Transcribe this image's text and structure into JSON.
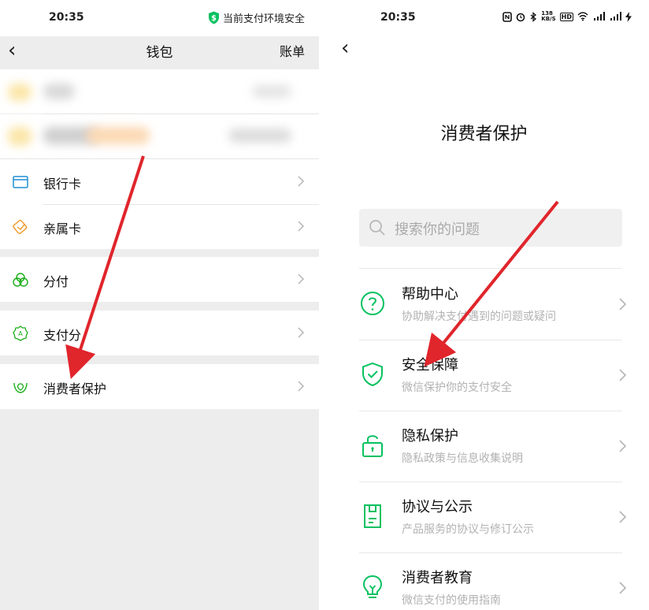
{
  "left": {
    "status": {
      "time": "20:35",
      "security_text": "当前支付环境安全"
    },
    "nav": {
      "back": "‹",
      "title": "钱包",
      "bills": "账单"
    },
    "items": [
      {
        "label": "银行卡",
        "icon": "bank-card-icon"
      },
      {
        "label": "亲属卡",
        "icon": "family-card-icon"
      },
      {
        "label": "分付",
        "icon": "fenfu-icon"
      },
      {
        "label": "支付分",
        "icon": "pay-score-icon"
      },
      {
        "label": "消费者保护",
        "icon": "consumer-protection-icon"
      }
    ]
  },
  "right": {
    "status": {
      "time": "20:35",
      "speed_top": "138",
      "speed_bottom": "KB/S",
      "hd": "HD"
    },
    "nav": {
      "back": "‹"
    },
    "title": "消费者保护",
    "search": {
      "placeholder": "搜索你的问题"
    },
    "items": [
      {
        "title": "帮助中心",
        "subtitle": "协助解决支付遇到的问题或疑问",
        "icon": "help-circle-icon"
      },
      {
        "title": "安全保障",
        "subtitle": "微信保护你的支付安全",
        "icon": "shield-check-icon"
      },
      {
        "title": "隐私保护",
        "subtitle": "隐私政策与信息收集说明",
        "icon": "lock-icon"
      },
      {
        "title": "协议与公示",
        "subtitle": "产品服务的协议与修订公示",
        "icon": "document-icon"
      },
      {
        "title": "消费者教育",
        "subtitle": "微信支付的使用指南",
        "icon": "lightbulb-icon"
      }
    ]
  },
  "colors": {
    "accent": "#07c160",
    "arrow": "#e0252b"
  }
}
